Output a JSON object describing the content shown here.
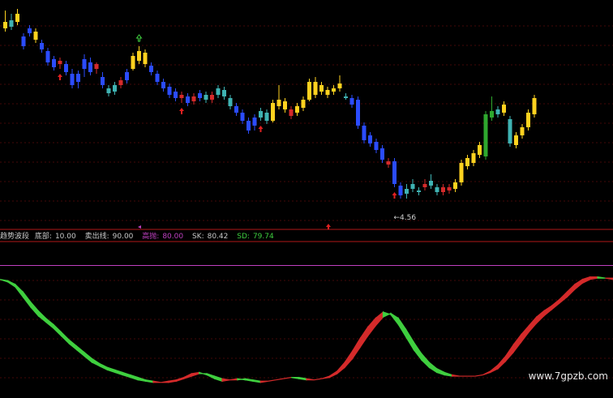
{
  "indicator": {
    "name": "趋势波段",
    "params": [
      {
        "label": "底部:",
        "value": "10.00",
        "color": "#d0d0d0"
      },
      {
        "label": "卖出线:",
        "value": "90.00",
        "color": "#d0d0d0"
      },
      {
        "label": "高抛:",
        "value": "80.00",
        "color": "#c040c0"
      },
      {
        "label": "SK:",
        "value": "80.42",
        "color": "#d0d0d0"
      },
      {
        "label": "SD:",
        "value": "79.74",
        "color": "#3fcf3f"
      }
    ]
  },
  "price_annotation": "←4.56",
  "watermark": "www.7gpzb.com",
  "colors": {
    "background": "#000000",
    "grid": "#8a1010",
    "candle_blue": "#2b4cff",
    "candle_yellow": "#ffd21f",
    "candle_cyan": "#3fb3b3",
    "candle_red": "#d42a2a",
    "candle_green": "#2ea82e",
    "band_up": "#d42a2a",
    "band_down": "#3fcf3f",
    "level_line": "#c040c0"
  },
  "chart_data": [
    {
      "type": "candlestick",
      "description_color_legend": "colors encode trend state",
      "low_label": 4.56,
      "candles": [
        [
          "y",
          30,
          22,
          8,
          34
        ],
        [
          "c",
          20,
          28,
          12,
          32
        ],
        [
          "y",
          22,
          12,
          6,
          26
        ],
        [
          "b",
          40,
          52,
          36,
          56
        ],
        [
          "b",
          36,
          30,
          26,
          40
        ],
        [
          "y",
          34,
          44,
          30,
          48
        ],
        [
          "b",
          48,
          56,
          44,
          60
        ],
        [
          "b",
          58,
          72,
          54,
          76
        ],
        [
          "b",
          68,
          78,
          64,
          82
        ],
        [
          "r",
          74,
          70,
          66,
          80
        ],
        [
          "b",
          74,
          84,
          70,
          88
        ],
        [
          "b",
          86,
          100,
          80,
          104
        ],
        [
          "b",
          96,
          86,
          82,
          104
        ],
        [
          "b",
          80,
          68,
          62,
          90
        ],
        [
          "b",
          72,
          84,
          66,
          88
        ],
        [
          "r",
          80,
          74,
          72,
          86
        ],
        [
          "b",
          90,
          100,
          84,
          104
        ],
        [
          "c",
          104,
          110,
          100,
          114
        ],
        [
          "c",
          108,
          100,
          96,
          112
        ],
        [
          "r",
          100,
          94,
          90,
          104
        ],
        [
          "b",
          94,
          84,
          80,
          98
        ],
        [
          "y",
          80,
          64,
          60,
          82
        ],
        [
          "y",
          70,
          58,
          52,
          74
        ],
        [
          "y",
          60,
          74,
          56,
          78
        ],
        [
          "b",
          76,
          84,
          72,
          88
        ],
        [
          "b",
          86,
          96,
          82,
          100
        ],
        [
          "b",
          96,
          104,
          92,
          108
        ],
        [
          "b",
          102,
          112,
          98,
          116
        ],
        [
          "b",
          108,
          116,
          104,
          120
        ],
        [
          "r",
          116,
          112,
          108,
          122
        ],
        [
          "b",
          114,
          122,
          110,
          126
        ],
        [
          "r",
          120,
          114,
          110,
          124
        ],
        [
          "b",
          116,
          110,
          106,
          120
        ],
        [
          "c",
          112,
          118,
          108,
          122
        ],
        [
          "r",
          118,
          112,
          108,
          122
        ],
        [
          "c",
          112,
          104,
          100,
          116
        ],
        [
          "c",
          106,
          114,
          102,
          118
        ],
        [
          "c",
          116,
          126,
          112,
          130
        ],
        [
          "b",
          126,
          134,
          122,
          138
        ],
        [
          "b",
          134,
          144,
          130,
          148
        ],
        [
          "b",
          144,
          156,
          140,
          160
        ],
        [
          "b",
          150,
          140,
          136,
          156
        ],
        [
          "c",
          140,
          132,
          128,
          144
        ],
        [
          "c",
          134,
          144,
          130,
          148
        ],
        [
          "y",
          144,
          122,
          118,
          146
        ],
        [
          "y",
          126,
          118,
          100,
          130
        ],
        [
          "y",
          120,
          130,
          116,
          134
        ],
        [
          "r",
          130,
          138,
          126,
          142
        ],
        [
          "y",
          134,
          126,
          122,
          138
        ],
        [
          "y",
          128,
          118,
          114,
          132
        ],
        [
          "y",
          118,
          96,
          92,
          120
        ],
        [
          "y",
          96,
          112,
          90,
          116
        ],
        [
          "y",
          108,
          100,
          96,
          112
        ],
        [
          "y",
          106,
          112,
          102,
          116
        ],
        [
          "y",
          108,
          104,
          100,
          112
        ],
        [
          "y",
          104,
          98,
          88,
          108
        ],
        [
          "c",
          116,
          114,
          110,
          118
        ],
        [
          "b",
          116,
          124,
          112,
          128
        ],
        [
          "b",
          118,
          150,
          114,
          154
        ],
        [
          "b",
          150,
          168,
          146,
          172
        ],
        [
          "b",
          162,
          172,
          158,
          176
        ],
        [
          "b",
          170,
          180,
          166,
          184
        ],
        [
          "b",
          178,
          192,
          174,
          196
        ],
        [
          "r",
          194,
          198,
          190,
          202
        ],
        [
          "b",
          194,
          222,
          190,
          226
        ],
        [
          "b",
          224,
          236,
          220,
          240
        ],
        [
          "c",
          228,
          234,
          222,
          240
        ],
        [
          "c",
          228,
          222,
          216,
          232
        ],
        [
          "c",
          230,
          232,
          226,
          236
        ],
        [
          "r",
          222,
          226,
          216,
          230
        ],
        [
          "c",
          224,
          218,
          210,
          228
        ],
        [
          "c",
          226,
          232,
          222,
          236
        ],
        [
          "r",
          232,
          226,
          222,
          236
        ],
        [
          "r",
          226,
          230,
          222,
          234
        ],
        [
          "y",
          228,
          220,
          216,
          232
        ],
        [
          "y",
          220,
          196,
          192,
          224
        ],
        [
          "y",
          200,
          190,
          186,
          204
        ],
        [
          "y",
          196,
          184,
          180,
          200
        ],
        [
          "y",
          186,
          174,
          170,
          190
        ],
        [
          "g",
          188,
          136,
          132,
          192
        ],
        [
          "g",
          140,
          132,
          114,
          144
        ],
        [
          "c",
          136,
          130,
          126,
          140
        ],
        [
          "y",
          134,
          124,
          120,
          138
        ],
        [
          "c",
          142,
          172,
          138,
          176
        ],
        [
          "y",
          174,
          162,
          158,
          178
        ],
        [
          "y",
          162,
          152,
          148,
          166
        ],
        [
          "y",
          152,
          134,
          130,
          156
        ],
        [
          "y",
          136,
          116,
          112,
          140
        ]
      ],
      "markers": [
        {
          "i": 9,
          "dir": "buy"
        },
        {
          "i": 22,
          "dir": "sell"
        },
        {
          "i": 29,
          "dir": "buy"
        },
        {
          "i": 42,
          "dir": "buy"
        },
        {
          "i": 64,
          "dir": "buy"
        }
      ]
    },
    {
      "type": "area",
      "series": [
        {
          "values": [
            86,
            84,
            80,
            72,
            64,
            57,
            52,
            47,
            41,
            35,
            30,
            25,
            20,
            17,
            14,
            12,
            10,
            8,
            6,
            5,
            4,
            4,
            5,
            6,
            8,
            11,
            12,
            10,
            7,
            5,
            6,
            7,
            6,
            5,
            4,
            5,
            6,
            7,
            8,
            7,
            6,
            6,
            7,
            9,
            13,
            20,
            29,
            39,
            48,
            55,
            60,
            58,
            50,
            40,
            30,
            22,
            16,
            12,
            10,
            9,
            9,
            9,
            9,
            10,
            13,
            18,
            25,
            34,
            42,
            49,
            56,
            61,
            65,
            70,
            76,
            82,
            86,
            88,
            88,
            87,
            87
          ]
        },
        {
          "values": [
            86,
            85,
            82,
            76,
            68,
            61,
            55,
            50,
            44,
            38,
            33,
            28,
            23,
            19,
            16,
            14,
            12,
            10,
            8,
            6,
            5,
            4,
            4,
            5,
            7,
            9,
            11,
            11,
            9,
            7,
            6,
            6,
            7,
            6,
            5,
            5,
            6,
            7,
            8,
            8,
            7,
            6,
            7,
            8,
            11,
            16,
            23,
            32,
            41,
            49,
            56,
            59,
            55,
            46,
            36,
            27,
            20,
            15,
            12,
            10,
            9,
            9,
            9,
            10,
            12,
            15,
            21,
            28,
            36,
            44,
            51,
            57,
            62,
            67,
            72,
            78,
            83,
            86,
            87,
            87,
            86
          ]
        }
      ],
      "ylim": [
        0,
        100
      ],
      "levels": [
        10,
        90
      ]
    }
  ]
}
